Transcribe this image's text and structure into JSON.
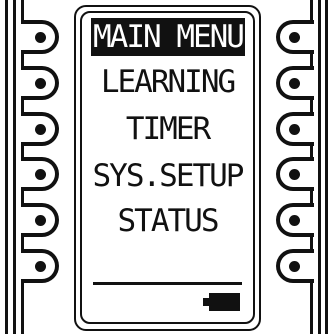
{
  "menu": {
    "title": "MAIN MENU",
    "items": [
      {
        "label": "LEARNING"
      },
      {
        "label": "TIMER"
      },
      {
        "label": "SYS.SETUP"
      },
      {
        "label": "STATUS"
      }
    ]
  },
  "status": {
    "battery_icon": "battery-icon",
    "battery_level": 1.0
  },
  "side_buttons": {
    "left_count": 6,
    "right_count": 6
  },
  "colors": {
    "ink": "#111111",
    "background": "#ffffff"
  }
}
